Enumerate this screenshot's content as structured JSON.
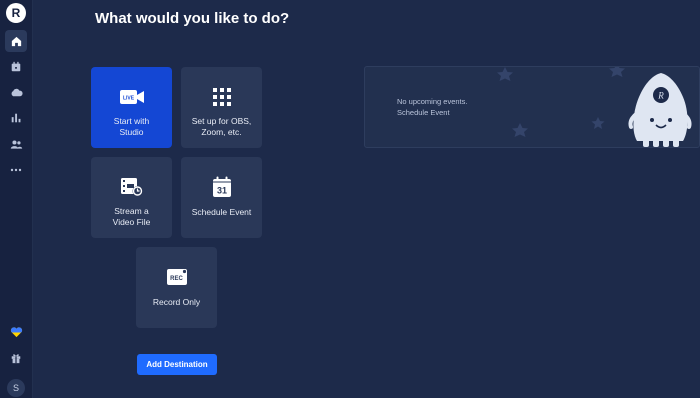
{
  "sidebar": {
    "logo": "R",
    "items": [
      {
        "icon": "home-icon"
      },
      {
        "icon": "calendar-icon"
      },
      {
        "icon": "cloud-icon"
      },
      {
        "icon": "analytics-icon"
      },
      {
        "icon": "team-icon"
      },
      {
        "icon": "more-icon"
      }
    ],
    "bottom": [
      {
        "icon": "heart-icon",
        "colors": [
          "#3b7bff",
          "#ffd400"
        ]
      },
      {
        "icon": "gift-icon"
      }
    ],
    "avatar": "S"
  },
  "main": {
    "title": "What would you like to do?",
    "tiles": [
      {
        "label": "Start with Studio",
        "icon": "live-camera-icon",
        "badge": "LIVE",
        "primary": true
      },
      {
        "label": "Set up for OBS, Zoom, etc.",
        "icon": "grid-icon"
      },
      {
        "label": "Stream a Video File",
        "icon": "video-file-icon"
      },
      {
        "label": "Schedule Event",
        "icon": "calendar-31-icon",
        "badge": "31"
      },
      {
        "label": "Record Only",
        "icon": "rec-icon",
        "badge": "REC"
      }
    ],
    "add_destination": "Add Destination"
  },
  "events": {
    "empty_text": "No upcoming events.",
    "schedule_link": "Schedule Event"
  },
  "colors": {
    "background": "#1d2a4a",
    "sidebar": "#172240",
    "tile": "#2a3858",
    "primary_tile": "#1447d4",
    "button": "#1f6bff"
  }
}
